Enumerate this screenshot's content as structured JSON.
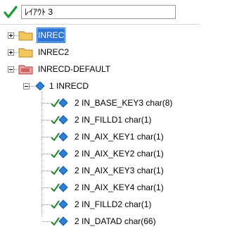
{
  "header": {
    "title": "ﾚｲｱｳﾄ 3"
  },
  "tree": {
    "nodes": [
      {
        "label": "INREC",
        "selected": true,
        "expanded": false,
        "icon": "folder-icon"
      },
      {
        "label": "INREC2",
        "expanded": false,
        "icon": "folder-icon"
      },
      {
        "label": "INRECD-DEFAULT",
        "expanded": true,
        "icon": "folder-red-icon"
      },
      {
        "label": "1 INRECD",
        "expanded": true,
        "icon": "diamond-icon"
      },
      {
        "label": "2 IN_BASE_KEY3 char(8)",
        "icon": "check-diamond-icon"
      },
      {
        "label": "2 IN_FILLD1 char(1)",
        "icon": "check-diamond-icon"
      },
      {
        "label": "2 IN_AIX_KEY1 char(1)",
        "icon": "check-diamond-icon"
      },
      {
        "label": "2 IN_AIX_KEY2 char(1)",
        "icon": "check-diamond-icon"
      },
      {
        "label": "2 IN_AIX_KEY3 char(1)",
        "icon": "check-diamond-icon"
      },
      {
        "label": "2 IN_AIX_KEY4 char(1)",
        "icon": "check-diamond-icon"
      },
      {
        "label": "2 IN_FILLD2 char(1)",
        "icon": "check-diamond-icon"
      },
      {
        "label": "2 IN_DATAD char(66)",
        "icon": "check-diamond-icon"
      }
    ]
  }
}
